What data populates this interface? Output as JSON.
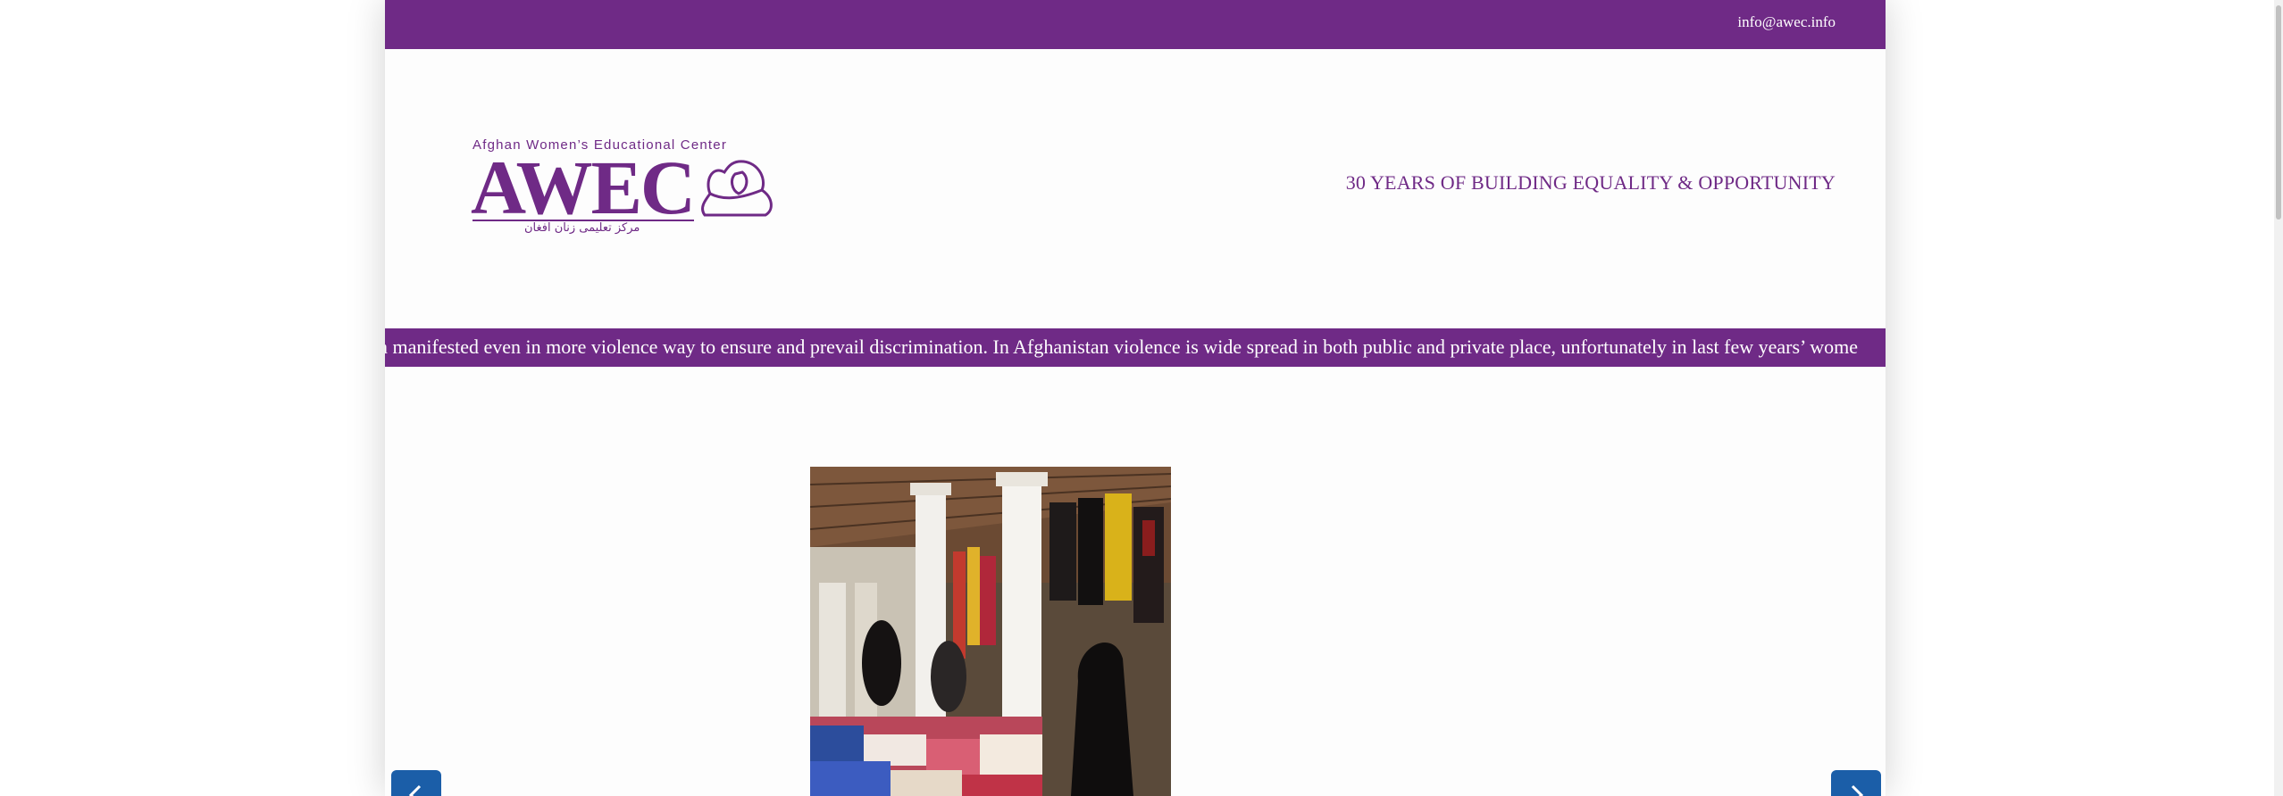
{
  "topbar": {
    "email": "info@awec.info"
  },
  "logo": {
    "small_text": "Afghan Women’s Educational Center",
    "main_text": "AWEC",
    "persian_text": "مرکز تعلیمی زنان افغان"
  },
  "header": {
    "tagline": "30 YEARS OF BUILDING EQUALITY & OPPORTUNITY"
  },
  "ticker": {
    "text": "n manifested even in more violence way to ensure and prevail discrimination. In Afghanistan violence is wide spread in both public and private place, unfortunately in last few years’ wome"
  },
  "slider": {
    "prev_icon": "chevron-left-icon",
    "next_icon": "chevron-right-icon"
  },
  "colors": {
    "brand_purple": "#6f2a86",
    "nav_blue": "#1b5ea8"
  }
}
